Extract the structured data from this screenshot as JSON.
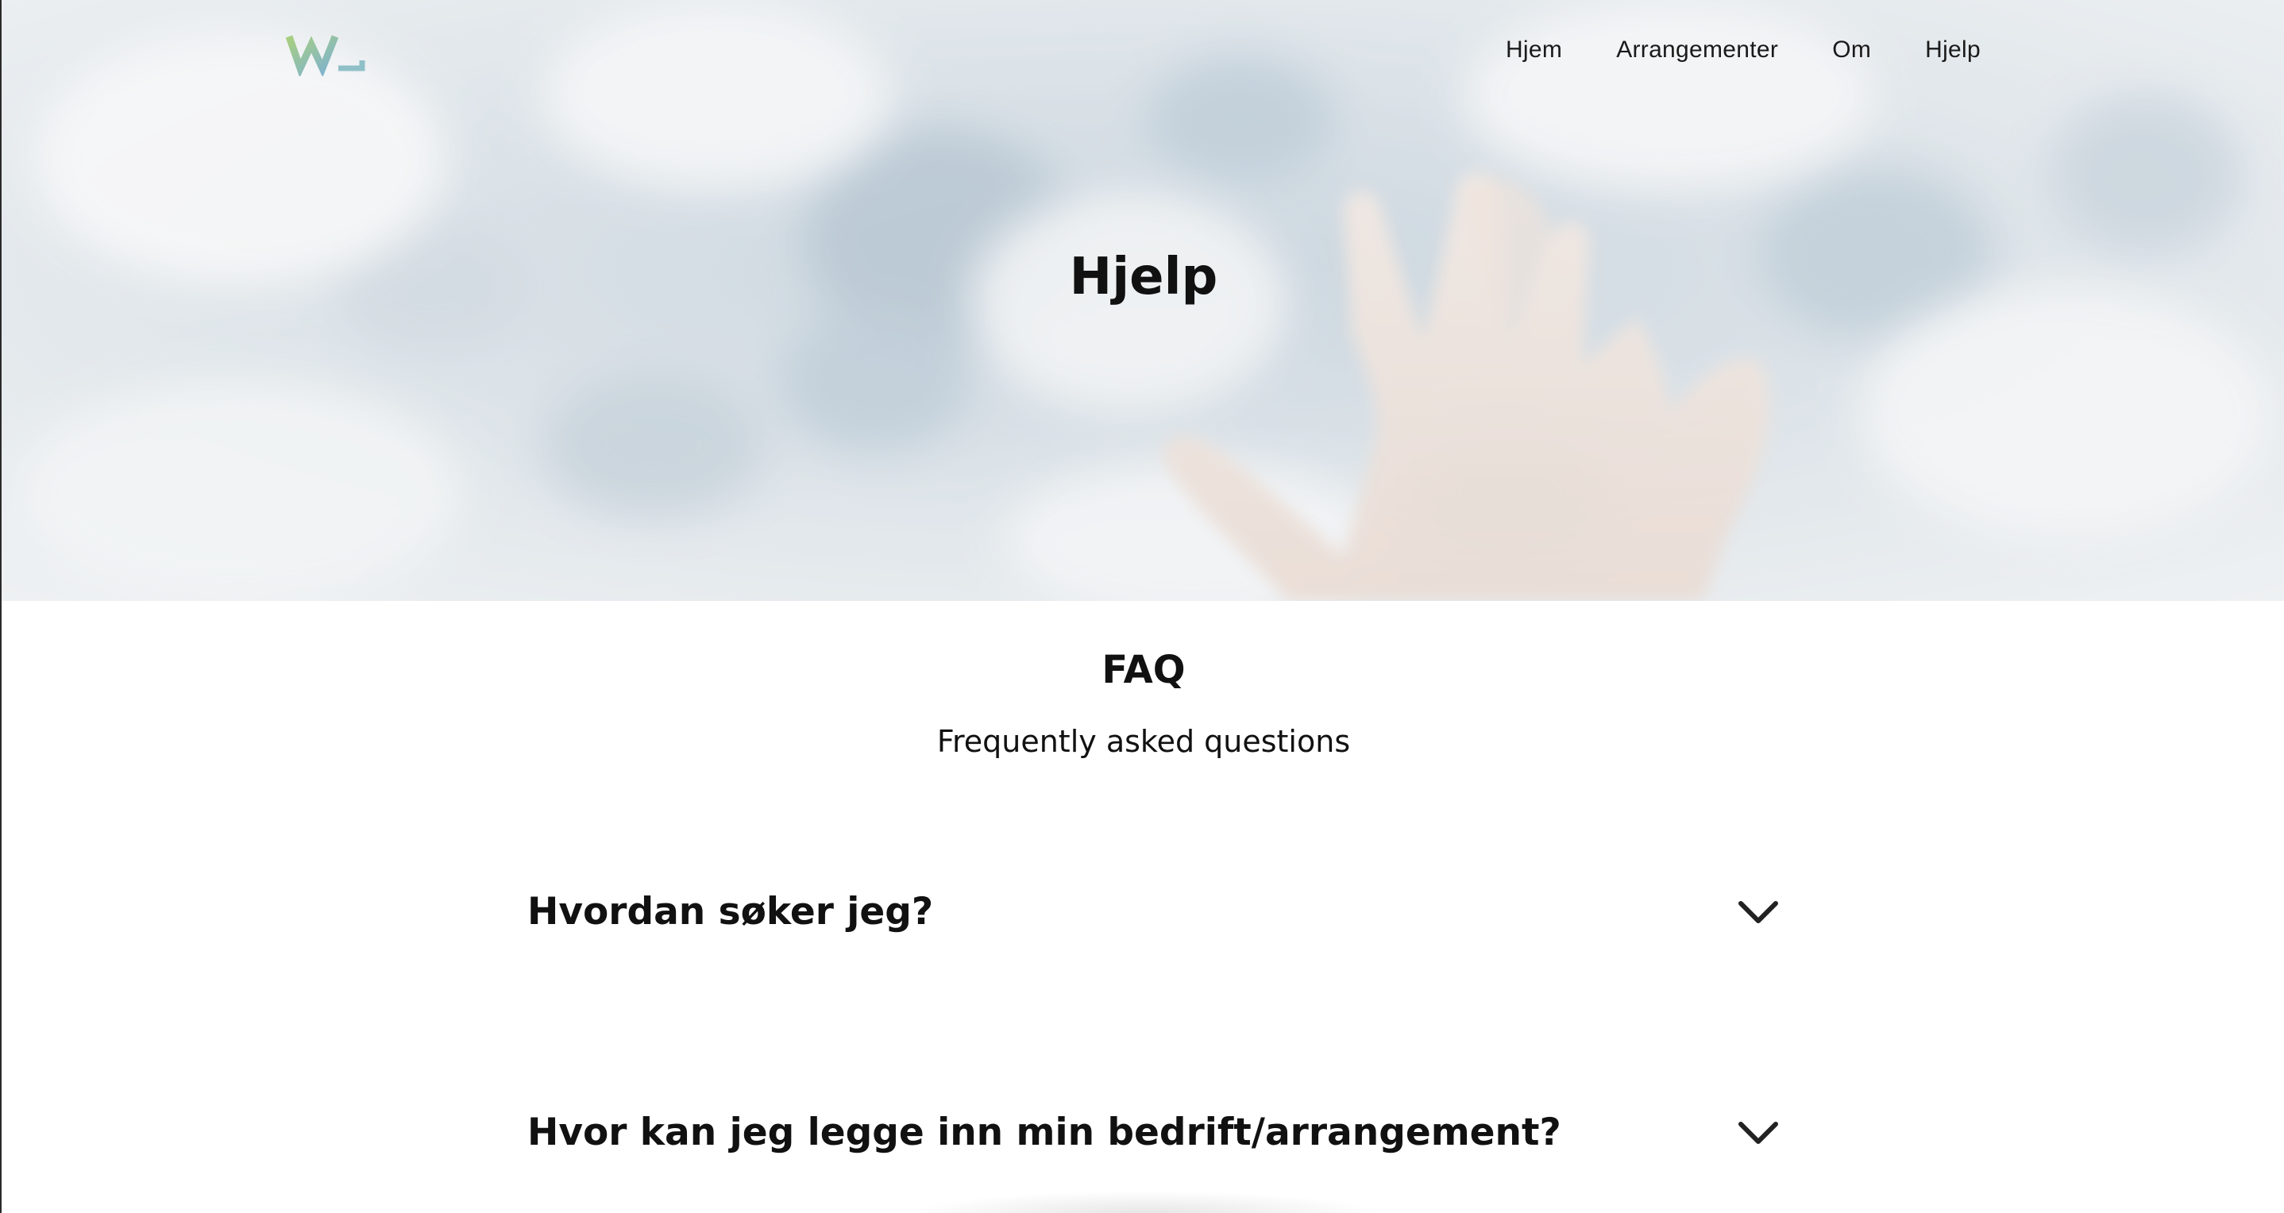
{
  "logo": {
    "alt": "WL",
    "colors": [
      "#8fc48a",
      "#9ab6cc"
    ]
  },
  "nav": {
    "items": [
      "Hjem",
      "Arrangementer",
      "Om",
      "Hjelp"
    ]
  },
  "hero": {
    "title": "Hjelp",
    "background": "sky-clouds-hand-photo"
  },
  "faq": {
    "heading": "FAQ",
    "subheading": "Frequently asked questions",
    "items": [
      {
        "question": "Hvordan søker jeg?",
        "icon": "chevron-down-icon"
      },
      {
        "question": "Hvor kan jeg legge inn min bedrift/arrangement?",
        "icon": "chevron-down-icon"
      }
    ]
  }
}
